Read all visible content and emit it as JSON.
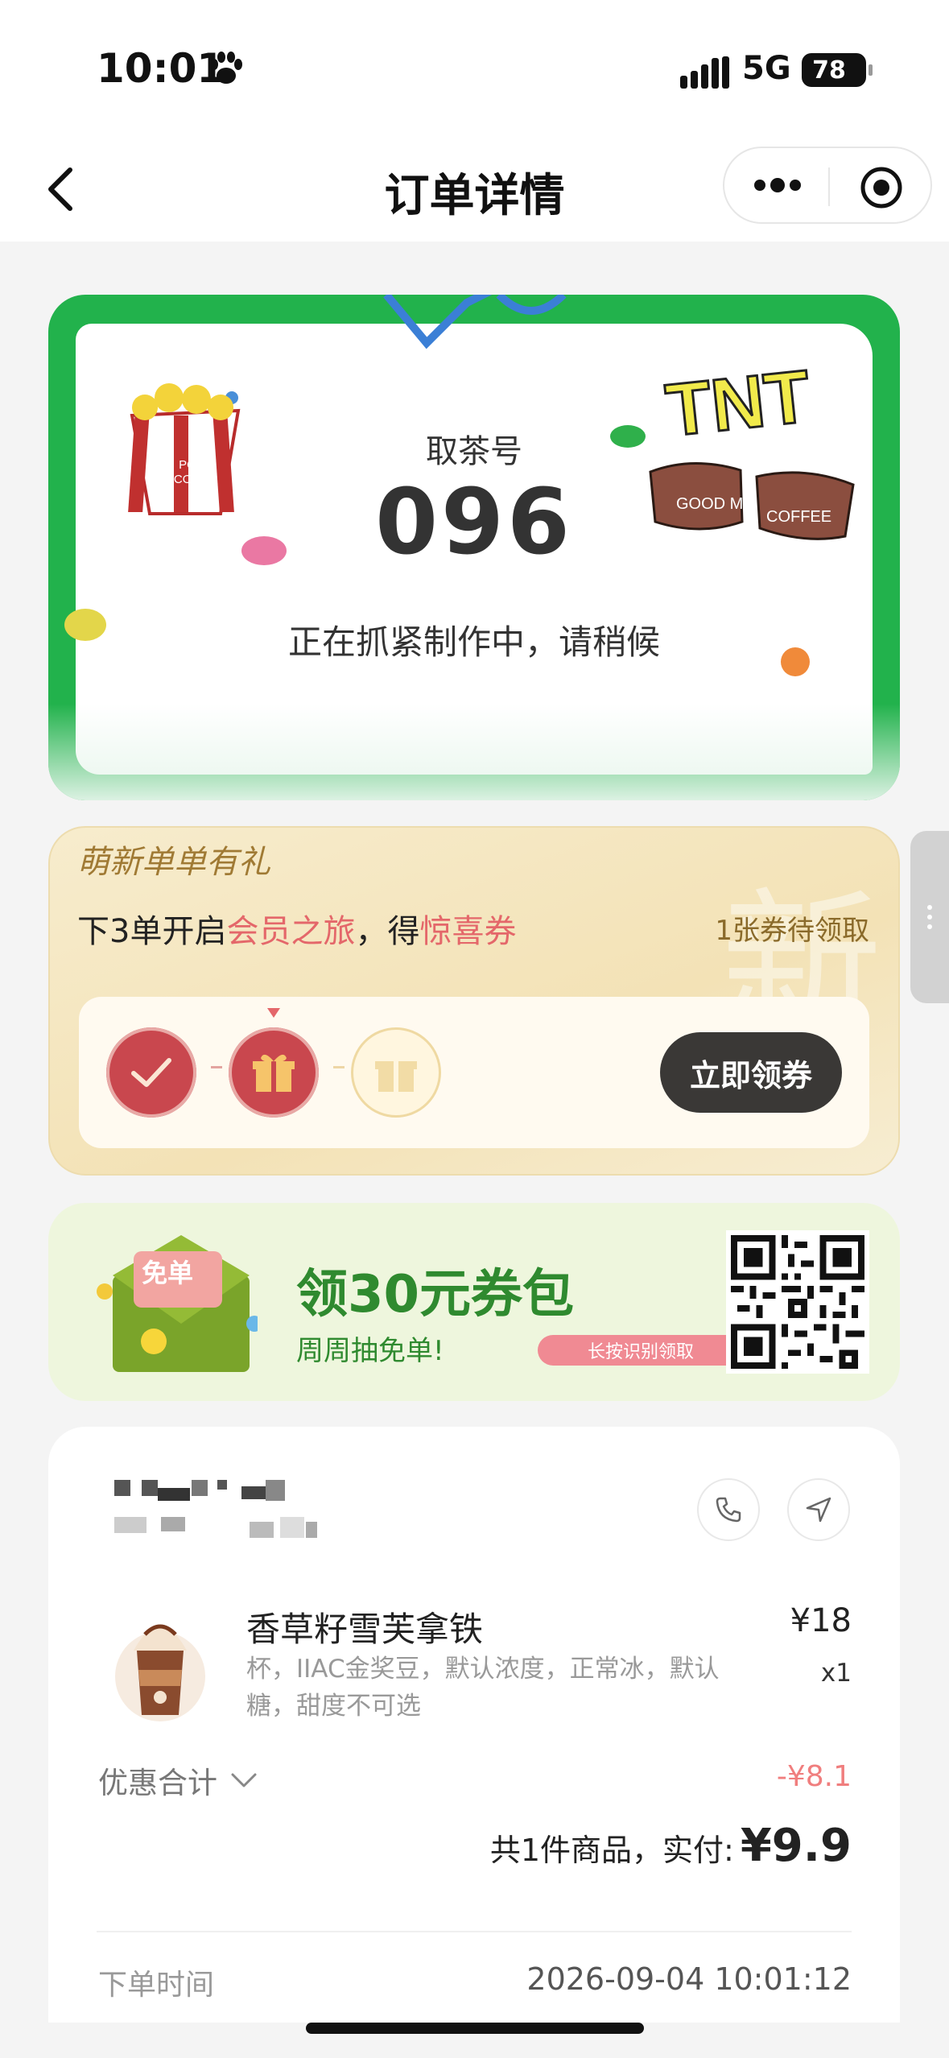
{
  "status_bar": {
    "time": "10:01",
    "network": "5G",
    "battery": "78"
  },
  "nav": {
    "title": "订单详情"
  },
  "pickup": {
    "label": "取茶号",
    "number": "096",
    "status": "正在抓紧制作中，请稍候",
    "decor_text": {
      "tnt": "TNT",
      "cup1": "GOOD ME",
      "cup2": "COFFEE",
      "popcorn": "POP CORN"
    }
  },
  "member": {
    "brand": "萌新单单有礼",
    "bg_char": "新",
    "headline_prefix": "下3单开启",
    "headline_highlight1": "会员之旅",
    "headline_mid": "，得",
    "headline_highlight2": "惊喜券",
    "pending": "1张券待领取",
    "claim_button": "立即领券"
  },
  "promo": {
    "badge": "免单",
    "title": "领30元券包",
    "subtitle": "周周抽免单!",
    "tag": "长按识别领取"
  },
  "order": {
    "product_name": "香草籽雪芙拿铁",
    "product_spec": "杯，IIAC金奖豆，默认浓度，正常冰，默认糖，甜度不可选",
    "price": "¥18",
    "quantity": "x1",
    "discount_label": "优惠合计",
    "discount_value": "-¥8.1",
    "total_text": "共1件商品，实付:",
    "total_amount": "¥9.9",
    "order_time_label": "下单时间",
    "order_time_value": "2026-09-04 10:01:12"
  },
  "colors": {
    "brand_green": "#22b24c",
    "highlight_red": "#e4676a",
    "discount_red": "#f07e7e",
    "promo_green": "#2f8a2f"
  }
}
